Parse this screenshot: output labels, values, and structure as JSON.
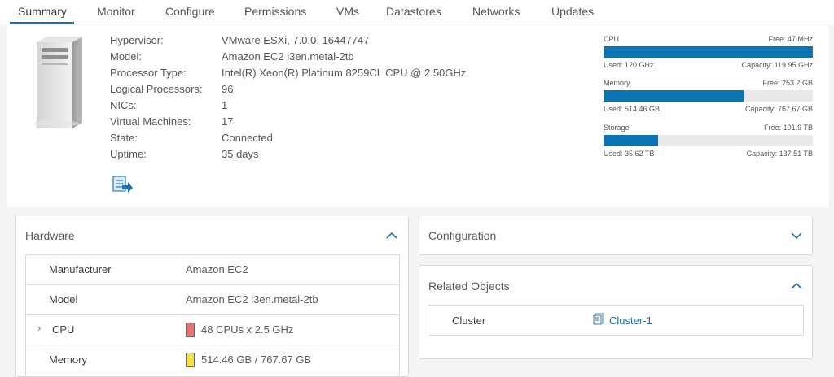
{
  "tabs": [
    {
      "label": "Summary",
      "active": true
    },
    {
      "label": "Monitor"
    },
    {
      "label": "Configure"
    },
    {
      "label": "Permissions"
    },
    {
      "label": "VMs"
    },
    {
      "label": "Datastores"
    },
    {
      "label": "Networks"
    },
    {
      "label": "Updates"
    }
  ],
  "host": {
    "properties": [
      {
        "label": "Hypervisor:",
        "value": "VMware ESXi, 7.0.0, 16447747"
      },
      {
        "label": "Model:",
        "value": "Amazon EC2 i3en.metal-2tb"
      },
      {
        "label": "Processor Type:",
        "value": "Intel(R) Xeon(R) Platinum 8259CL CPU @ 2.50GHz"
      },
      {
        "label": "Logical Processors:",
        "value": "96"
      },
      {
        "label": "NICs:",
        "value": "1"
      },
      {
        "label": "Virtual Machines:",
        "value": "17"
      },
      {
        "label": "State:",
        "value": "Connected"
      },
      {
        "label": "Uptime:",
        "value": "35 days"
      }
    ],
    "icons": {
      "server": "server-tower-icon",
      "action": "migrate-host-icon"
    }
  },
  "resources": [
    {
      "name": "CPU",
      "free": "Free: 47 MHz",
      "used": "Used: 120 GHz",
      "capacity": "Capacity: 119.95 GHz",
      "usage_fraction": 1.0
    },
    {
      "name": "Memory",
      "free": "Free: 253.2 GB",
      "used": "Used: 514.46 GB",
      "capacity": "Capacity: 767.67 GB",
      "usage_fraction": 0.67
    },
    {
      "name": "Storage",
      "free": "Free: 101.9 TB",
      "used": "Used: 35.62 TB",
      "capacity": "Capacity: 137.51 TB",
      "usage_fraction": 0.26
    }
  ],
  "hardware": {
    "title": "Hardware",
    "rows": [
      {
        "label": "Manufacturer",
        "value": "Amazon EC2"
      },
      {
        "label": "Model",
        "value": "Amazon EC2 i3en.metal-2tb"
      },
      {
        "label": "CPU",
        "value": "48 CPUs x 2.5 GHz",
        "swatch_color": "#e8736e"
      },
      {
        "label": "Memory",
        "value": "514.46 GB / 767.67 GB",
        "swatch_color": "#f2e33c"
      }
    ]
  },
  "configuration": {
    "title": "Configuration"
  },
  "related_objects": {
    "title": "Related Objects",
    "items": [
      {
        "label": "Cluster",
        "value": "Cluster-1",
        "icon": "cluster-icon"
      }
    ]
  },
  "colors": {
    "accent": "#0a75b2",
    "link": "#1a73a9",
    "tab_underline": "#1d6fa8"
  }
}
